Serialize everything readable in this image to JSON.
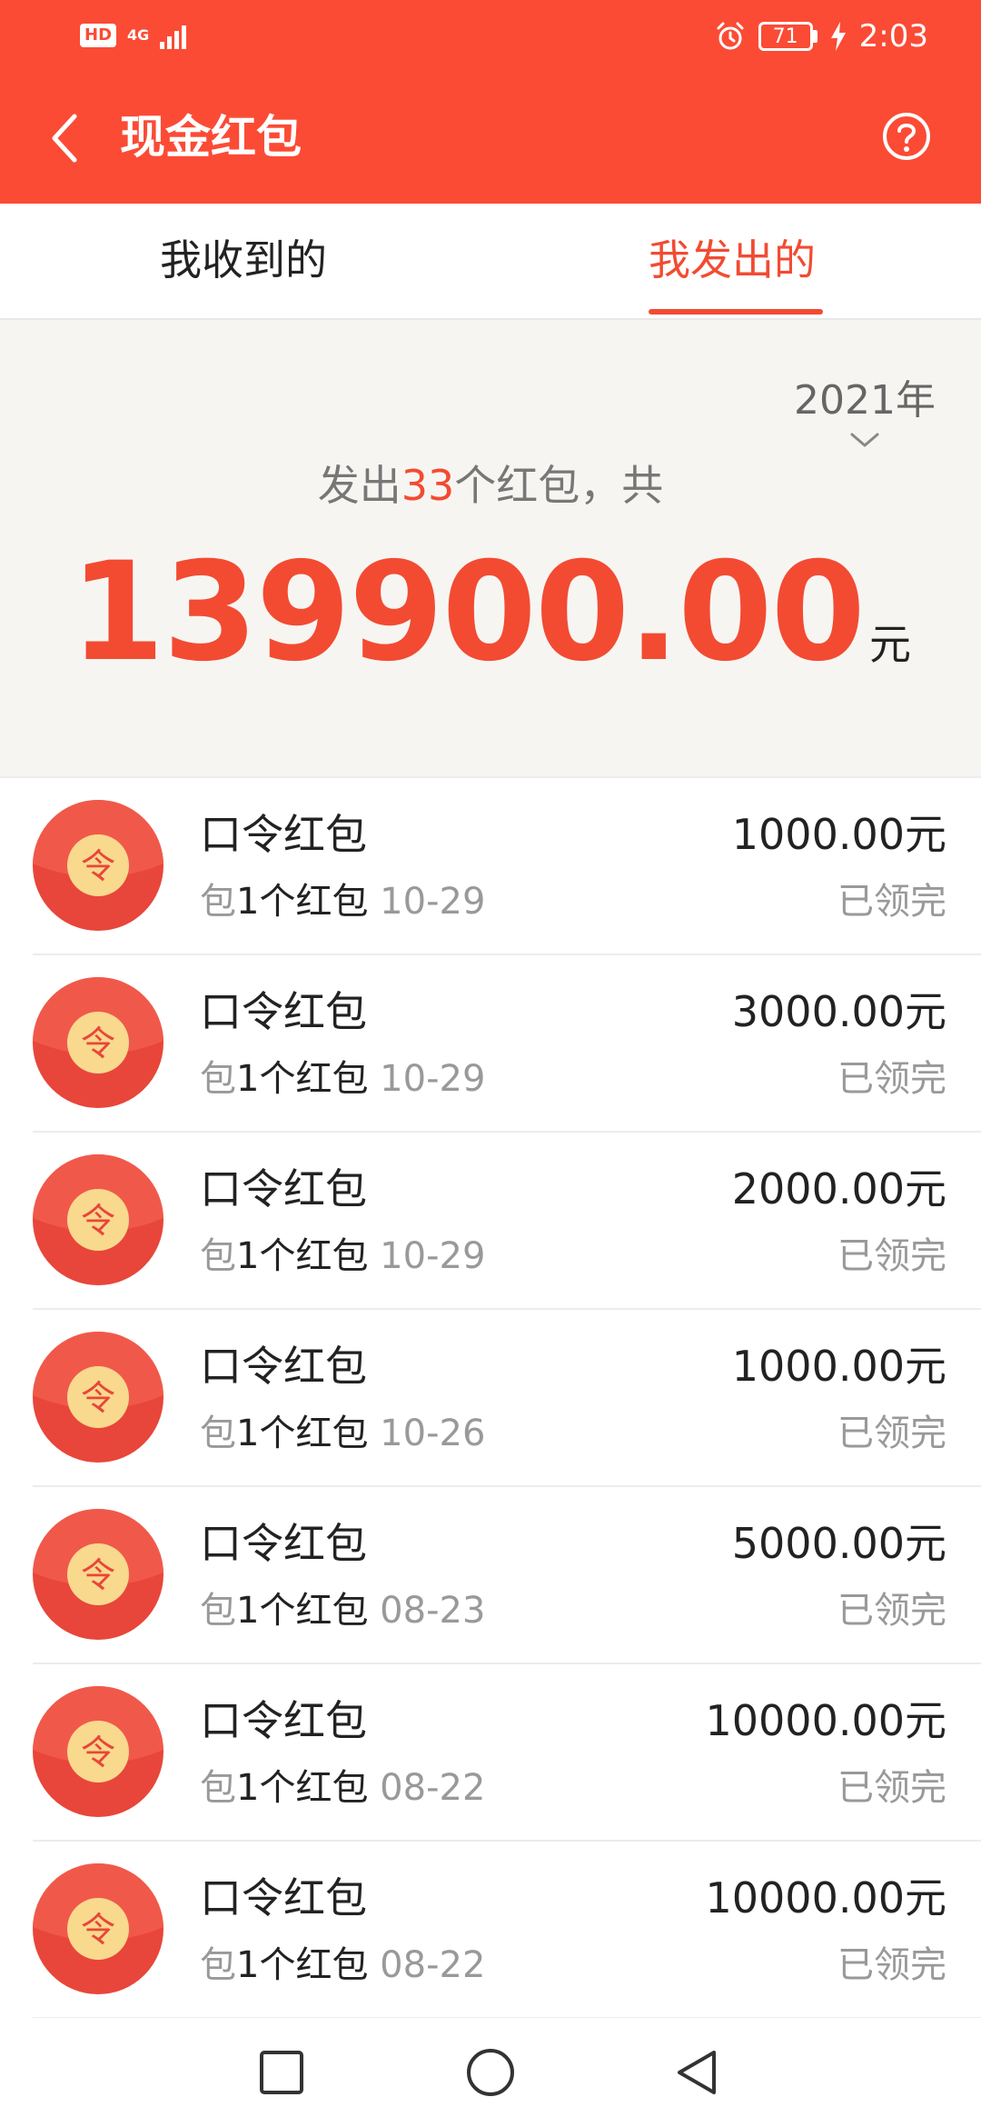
{
  "status_bar": {
    "hd_badge": "HD",
    "network": "4G",
    "battery": "71",
    "time": "2:03"
  },
  "header": {
    "title": "现金红包"
  },
  "tabs": [
    {
      "label": "我收到的",
      "active": false
    },
    {
      "label": "我发出的",
      "active": true
    }
  ],
  "summary": {
    "year": "2021年",
    "sent_prefix": "发出",
    "sent_count": "33",
    "sent_suffix": "个红包，共",
    "total_amount": "139900.00",
    "total_unit": "元"
  },
  "packets": [
    {
      "title": "口令红包",
      "sub_prefix": "包",
      "sub_count": "1个红包",
      "date": "10-29",
      "amount": "1000.00元",
      "status": "已领完"
    },
    {
      "title": "口令红包",
      "sub_prefix": "包",
      "sub_count": "1个红包",
      "date": "10-29",
      "amount": "3000.00元",
      "status": "已领完"
    },
    {
      "title": "口令红包",
      "sub_prefix": "包",
      "sub_count": "1个红包",
      "date": "10-29",
      "amount": "2000.00元",
      "status": "已领完"
    },
    {
      "title": "口令红包",
      "sub_prefix": "包",
      "sub_count": "1个红包",
      "date": "10-26",
      "amount": "1000.00元",
      "status": "已领完"
    },
    {
      "title": "口令红包",
      "sub_prefix": "包",
      "sub_count": "1个红包",
      "date": "08-23",
      "amount": "5000.00元",
      "status": "已领完"
    },
    {
      "title": "口令红包",
      "sub_prefix": "包",
      "sub_count": "1个红包",
      "date": "08-22",
      "amount": "10000.00元",
      "status": "已领完"
    },
    {
      "title": "口令红包",
      "sub_prefix": "包",
      "sub_count": "1个红包",
      "date": "08-22",
      "amount": "10000.00元",
      "status": "已领完"
    }
  ],
  "icons": {
    "packet_glyph": "令"
  },
  "colors": {
    "brand": "#fb4b35",
    "accent_text": "#f24b32",
    "packet_red": "#e8463a",
    "packet_gold": "#f8d98e"
  }
}
